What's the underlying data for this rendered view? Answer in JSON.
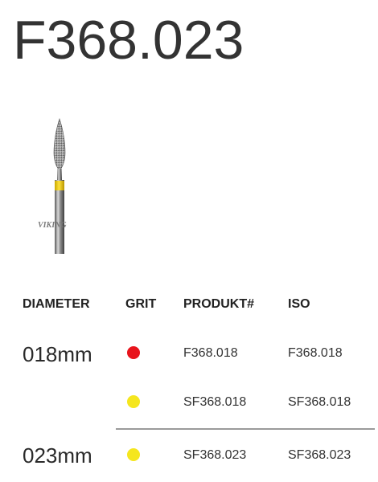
{
  "title": "F368.023",
  "image": {
    "logo_text": "Viking",
    "band_color": "#f2d21a"
  },
  "table": {
    "headers": {
      "diameter": "DIAMETER",
      "grit": "GRIT",
      "product": "PRODUKT#",
      "iso": "ISO"
    },
    "rows": [
      {
        "diameter": "018mm",
        "grit_color": "#e8141c",
        "product": "F368.018",
        "iso": "F368.018"
      },
      {
        "diameter": "",
        "grit_color": "#f5e61e",
        "product": "SF368.018",
        "iso": "SF368.018"
      },
      {
        "diameter": "023mm",
        "grit_color": "#f5e61e",
        "product": "SF368.023",
        "iso": "SF368.023"
      }
    ]
  }
}
